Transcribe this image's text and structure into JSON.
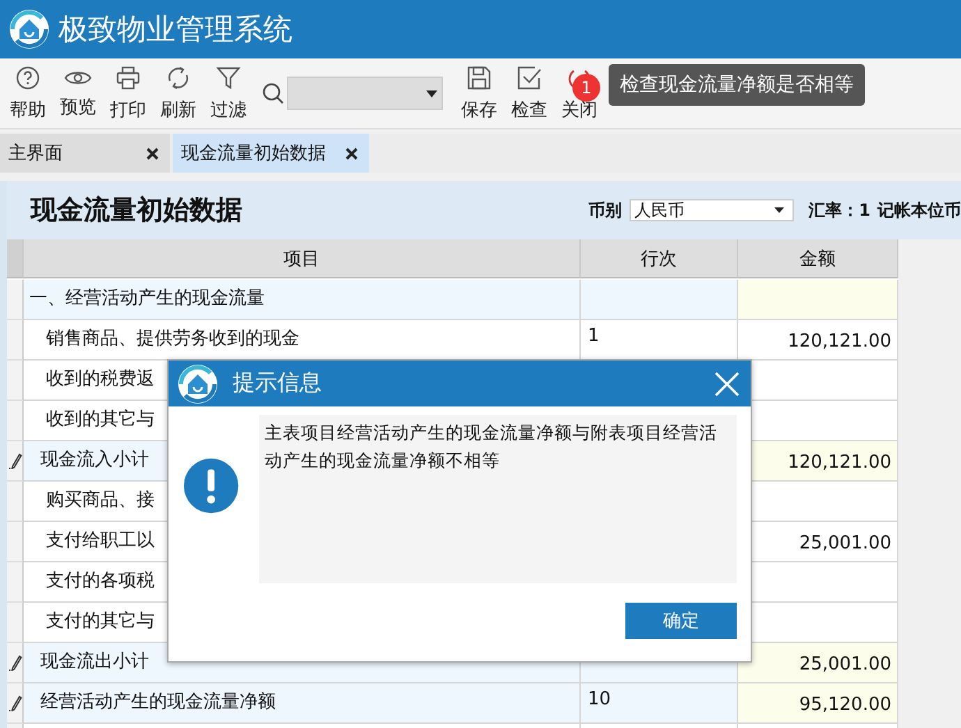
{
  "app": {
    "title": "极致物业管理系统"
  },
  "toolbar": {
    "left": [
      "帮助",
      "预览",
      "打印",
      "刷新",
      "过滤"
    ],
    "right": [
      "保存",
      "检查",
      "关闭"
    ],
    "badge": "1",
    "tooltip": "检查现金流量净额是否相等"
  },
  "tabs": [
    {
      "label": "主界面",
      "selected": false
    },
    {
      "label": "现金流量初始数据",
      "selected": true
    }
  ],
  "header": {
    "title": "现金流量初始数据",
    "currency_label": "币别",
    "currency": "人民币",
    "rate": "汇率：1",
    "base_currency": "记帐本位币"
  },
  "table": {
    "columns": [
      "项目",
      "行次",
      "金额"
    ],
    "rows": [
      {
        "kind": "section",
        "item": "一、经营活动产生的现金流量",
        "line": "",
        "amount": ""
      },
      {
        "kind": "item",
        "item": "销售商品、提供劳务收到的现金",
        "line": "1",
        "amount": "120,121.00"
      },
      {
        "kind": "item",
        "item": "收到的税费返",
        "line": "",
        "amount": ""
      },
      {
        "kind": "item",
        "item": "收到的其它与",
        "line": "",
        "amount": ""
      },
      {
        "kind": "subtotal",
        "item": "现金流入小计",
        "line": "",
        "amount": "120,121.00"
      },
      {
        "kind": "item",
        "item": "购买商品、接",
        "line": "",
        "amount": ""
      },
      {
        "kind": "item",
        "item": "支付给职工以",
        "line": "",
        "amount": "25,001.00"
      },
      {
        "kind": "item",
        "item": "支付的各项税",
        "line": "",
        "amount": ""
      },
      {
        "kind": "item",
        "item": "支付的其它与",
        "line": "",
        "amount": ""
      },
      {
        "kind": "subtotal",
        "item": "现金流出小计",
        "line": "",
        "amount": "25,001.00"
      },
      {
        "kind": "subtotal",
        "item": "经营活动产生的现金流量净额",
        "line": "10",
        "amount": "95,120.00"
      }
    ]
  },
  "dialog": {
    "title": "提示信息",
    "message": "主表项目经营活动产生的现金流量净额与附表项目经营活动产生的现金流量净额不相等",
    "ok": "确定"
  }
}
